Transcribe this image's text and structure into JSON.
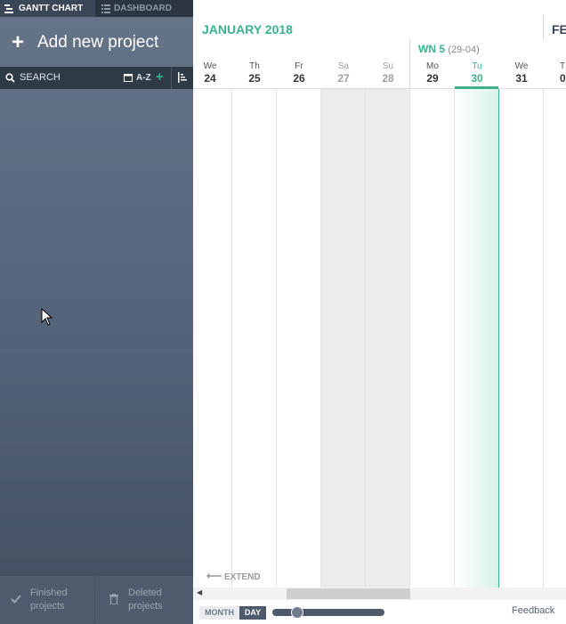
{
  "tabs": {
    "gantt_label": "GANTT CHART",
    "dashboard_label": "DASHBOARD"
  },
  "sidebar": {
    "add_project_label": "Add new project",
    "search_label": "SEARCH",
    "sort_label": "A-Z",
    "footer": {
      "finished_label": "Finished\nprojects",
      "deleted_label": "Deleted\nprojects"
    }
  },
  "calendar": {
    "month_current": "JANUARY 2018",
    "month_next": "FE",
    "week_label": "WN 5",
    "week_range": "(29-04)",
    "days": [
      {
        "dow": "We",
        "num": "24",
        "type": "normal"
      },
      {
        "dow": "Th",
        "num": "25",
        "type": "normal"
      },
      {
        "dow": "Fr",
        "num": "26",
        "type": "normal"
      },
      {
        "dow": "Sa",
        "num": "27",
        "type": "weekend"
      },
      {
        "dow": "Su",
        "num": "28",
        "type": "weekend"
      },
      {
        "dow": "Mo",
        "num": "29",
        "type": "normal"
      },
      {
        "dow": "Tu",
        "num": "30",
        "type": "today"
      },
      {
        "dow": "We",
        "num": "31",
        "type": "normal"
      },
      {
        "dow": "T",
        "num": "0",
        "type": "normal"
      }
    ],
    "extend_label": "EXTEND"
  },
  "zoom": {
    "month_label": "MONTH",
    "day_label": "DAY",
    "level": 0.17
  },
  "footer": {
    "feedback_label": "Feedback"
  },
  "colors": {
    "accent": "#3bb28d",
    "sidebar_dark": "#2c3642",
    "sidebar_mid": "#56647a"
  }
}
